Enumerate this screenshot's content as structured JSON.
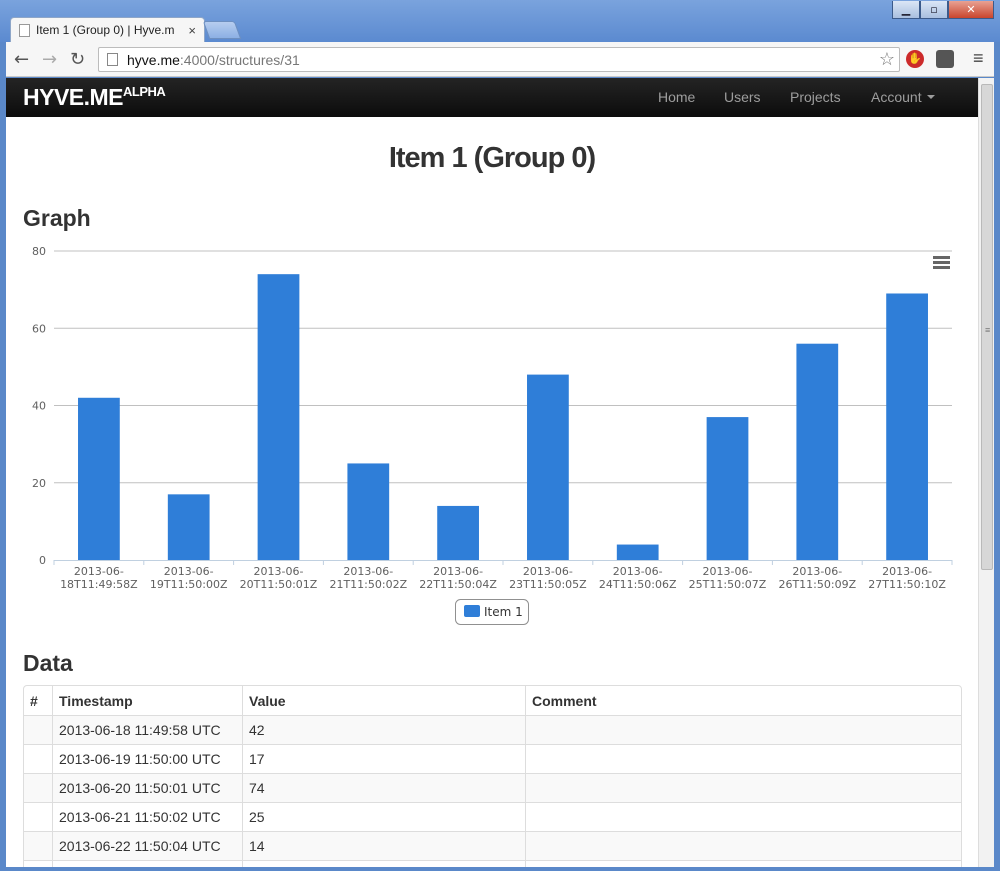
{
  "browser": {
    "tab_title": "Item 1 (Group 0) | Hyve.m",
    "tab_close": "×",
    "url_host": "hyve.me",
    "url_path": ":4000/structures/31"
  },
  "navbar": {
    "brand": "HYVE.ME",
    "brand_sup": "ALPHA",
    "links": [
      "Home",
      "Users",
      "Projects",
      "Account"
    ]
  },
  "page": {
    "title": "Item 1 (Group 0)",
    "graph_heading": "Graph",
    "data_heading": "Data"
  },
  "colors": {
    "bar": "#2f7ed8",
    "navbar": "#1b1b1b"
  },
  "chart_data": {
    "type": "bar",
    "categories": [
      "2013-06-18T11:49:58Z",
      "2013-06-19T11:50:00Z",
      "2013-06-20T11:50:01Z",
      "2013-06-21T11:50:02Z",
      "2013-06-22T11:50:04Z",
      "2013-06-23T11:50:05Z",
      "2013-06-24T11:50:06Z",
      "2013-06-25T11:50:07Z",
      "2013-06-26T11:50:09Z",
      "2013-06-27T11:50:10Z"
    ],
    "series": [
      {
        "name": "Item 1",
        "values": [
          42,
          17,
          74,
          25,
          14,
          48,
          4,
          37,
          56,
          69
        ]
      }
    ],
    "yticks": [
      0,
      20,
      40,
      60,
      80
    ],
    "ylim": [
      0,
      80
    ],
    "grid": true,
    "legend": "bottom-center"
  },
  "table": {
    "headers": [
      "#",
      "Timestamp",
      "Value",
      "Comment"
    ],
    "rows": [
      [
        "",
        "2013-06-18 11:49:58 UTC",
        "42",
        ""
      ],
      [
        "",
        "2013-06-19 11:50:00 UTC",
        "17",
        ""
      ],
      [
        "",
        "2013-06-20 11:50:01 UTC",
        "74",
        ""
      ],
      [
        "",
        "2013-06-21 11:50:02 UTC",
        "25",
        ""
      ],
      [
        "",
        "2013-06-22 11:50:04 UTC",
        "14",
        ""
      ],
      [
        "",
        "",
        "",
        ""
      ]
    ]
  }
}
